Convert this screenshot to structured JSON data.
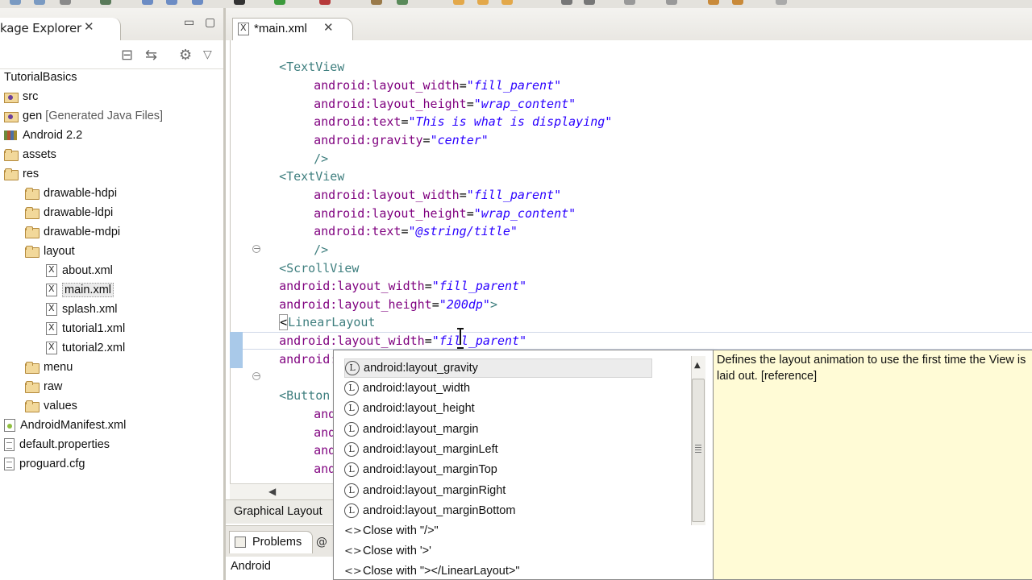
{
  "package_explorer": {
    "tab_label": "kage Explorer",
    "project_name": "TutorialBasics",
    "tree": [
      {
        "label": "src",
        "note": "",
        "icon": "source-folder-icon"
      },
      {
        "label": "gen",
        "note": "[Generated Java Files]",
        "icon": "source-folder-icon"
      },
      {
        "label": "Android 2.2",
        "note": "",
        "icon": "library-icon"
      },
      {
        "label": "assets",
        "note": "",
        "icon": "folder-icon"
      },
      {
        "label": "res",
        "note": "",
        "icon": "folder-icon"
      },
      {
        "label": "drawable-hdpi",
        "note": "",
        "icon": "folder-icon"
      },
      {
        "label": "drawable-ldpi",
        "note": "",
        "icon": "folder-icon"
      },
      {
        "label": "drawable-mdpi",
        "note": "",
        "icon": "folder-icon"
      },
      {
        "label": "layout",
        "note": "",
        "icon": "folder-icon"
      },
      {
        "label": "about.xml",
        "note": "",
        "icon": "xml-file-icon"
      },
      {
        "label": "main.xml",
        "note": "",
        "icon": "xml-file-icon"
      },
      {
        "label": "splash.xml",
        "note": "",
        "icon": "xml-file-icon"
      },
      {
        "label": "tutorial1.xml",
        "note": "",
        "icon": "xml-file-icon"
      },
      {
        "label": "tutorial2.xml",
        "note": "",
        "icon": "xml-file-icon"
      },
      {
        "label": "menu",
        "note": "",
        "icon": "folder-icon"
      },
      {
        "label": "raw",
        "note": "",
        "icon": "folder-icon"
      },
      {
        "label": "values",
        "note": "",
        "icon": "folder-icon"
      },
      {
        "label": "AndroidManifest.xml",
        "note": "",
        "icon": "manifest-file-icon"
      },
      {
        "label": "default.properties",
        "note": "",
        "icon": "file-icon"
      },
      {
        "label": "proguard.cfg",
        "note": "",
        "icon": "file-icon"
      }
    ]
  },
  "editor": {
    "tab_label": "*main.xml",
    "lines": [
      [
        "<TextView"
      ],
      [
        "android:layout_width",
        "=",
        "\"fill_parent\""
      ],
      [
        "android:layout_height",
        "=",
        "\"wrap_content\""
      ],
      [
        "android:text",
        "=",
        "\"This is what is displaying\""
      ],
      [
        "android:gravity",
        "=",
        "\"center\""
      ],
      [
        "/>"
      ],
      [
        "<TextView"
      ],
      [
        "android:layout_width",
        "=",
        "\"fill_parent\""
      ],
      [
        "android:layout_height",
        "=",
        "\"wrap_content\""
      ],
      [
        "android:text",
        "=",
        "\"@string/title\""
      ],
      [
        "/>"
      ],
      [
        "<ScrollView"
      ],
      [
        "android:layout_width",
        "=",
        "\"fill_parent\""
      ],
      [
        "android:layout_height",
        "=",
        "\"200dp\"",
        ">"
      ],
      [
        "<",
        "LinearLayout"
      ],
      [
        "android:layout_width",
        "=",
        "\"fill_parent\""
      ],
      [
        "android:layout_"
      ],
      [
        "<Button"
      ],
      [
        "andr"
      ],
      [
        "andr"
      ],
      [
        "andr"
      ],
      [
        "andr"
      ],
      [
        "andr"
      ]
    ],
    "mode_tab": "Graphical Layout"
  },
  "bottom_panel": {
    "problems_label": "Problems",
    "at_label": "@",
    "android_label": "Android"
  },
  "autocomplete": {
    "items": [
      {
        "label": "android:layout_gravity",
        "kind": "L"
      },
      {
        "label": "android:layout_width",
        "kind": "L"
      },
      {
        "label": "android:layout_height",
        "kind": "L"
      },
      {
        "label": "android:layout_margin",
        "kind": "L"
      },
      {
        "label": "android:layout_marginLeft",
        "kind": "L"
      },
      {
        "label": "android:layout_marginTop",
        "kind": "L"
      },
      {
        "label": "android:layout_marginRight",
        "kind": "L"
      },
      {
        "label": "android:layout_marginBottom",
        "kind": "L"
      },
      {
        "label": "Close with \"/>\"",
        "kind": "<>"
      },
      {
        "label": "Close with '>'",
        "kind": "<>"
      },
      {
        "label": "Close with \"></LinearLayout>\"",
        "kind": "<>"
      }
    ],
    "doc_text": "Defines the layout animation to use the first time the View is laid out. [reference]"
  },
  "colors": {
    "tag": "#3f7f7f",
    "attribute": "#7f007f",
    "value": "#2a00ff",
    "doc_background": "#fffbd6",
    "gutter_highlight": "#a9c9e9"
  }
}
